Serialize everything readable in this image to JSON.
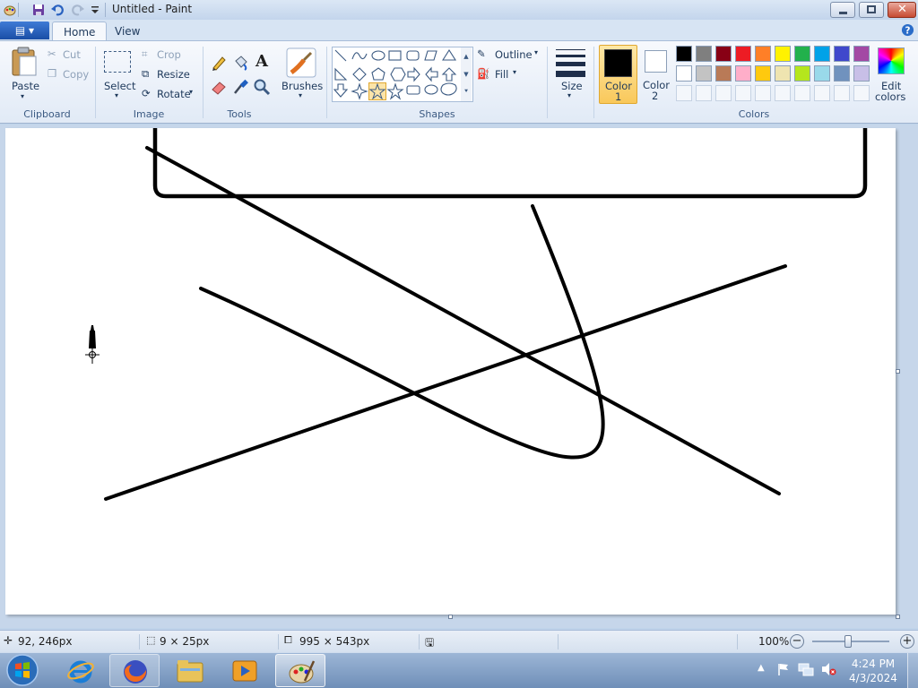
{
  "window": {
    "title": "Untitled - Paint",
    "quick_access": [
      "paint-app-icon",
      "save-icon",
      "undo-icon",
      "redo-icon",
      "customize-qat-icon"
    ],
    "controls": [
      "minimize",
      "maximize",
      "close"
    ]
  },
  "tabs": {
    "file_icon": "file-menu-icon",
    "home": "Home",
    "view": "View"
  },
  "clipboard": {
    "paste": "Paste",
    "cut": "Cut",
    "copy": "Copy",
    "group": "Clipboard"
  },
  "image": {
    "select": "Select",
    "crop": "Crop",
    "resize": "Resize",
    "rotate": "Rotate",
    "group": "Image"
  },
  "tools": {
    "items": [
      "pencil-icon",
      "fill-icon",
      "text-icon",
      "eraser-icon",
      "color-picker-icon",
      "magnifier-icon"
    ],
    "text_glyph": "A",
    "group": "Tools"
  },
  "brushes": {
    "label": "Brushes"
  },
  "shapes": {
    "outline": "Outline",
    "fill": "Fill",
    "group": "Shapes",
    "selected": "star-5"
  },
  "size": {
    "label": "Size"
  },
  "colors": {
    "color1": {
      "label1": "Color",
      "label2": "1",
      "value": "#000000"
    },
    "color2": {
      "label1": "Color",
      "label2": "2",
      "value": "#ffffff"
    },
    "palette_row1": [
      "#000000",
      "#7f7f7f",
      "#880015",
      "#ed1c24",
      "#ff7f27",
      "#fff200",
      "#22b14c",
      "#00a2e8",
      "#3f48cc",
      "#a349a4"
    ],
    "palette_row2": [
      "#ffffff",
      "#c3c3c3",
      "#b97a57",
      "#ffaec9",
      "#ffc90e",
      "#efe4b0",
      "#b5e61d",
      "#99d9ea",
      "#7092be",
      "#c8bfe7"
    ],
    "edit_label1": "Edit",
    "edit_label2": "colors",
    "group": "Colors"
  },
  "status": {
    "cursor_pos": "92, 246px",
    "selection_size": "9 × 25px",
    "canvas_size": "995 × 543px",
    "zoom": "100%",
    "zoom_fraction": 0.46
  },
  "taskbar": {
    "apps": [
      "start-button",
      "internet-explorer-icon",
      "firefox-icon",
      "file-explorer-icon",
      "media-player-icon",
      "paint-taskbar-icon"
    ],
    "active": "paint-taskbar-icon",
    "time": "4:24 PM",
    "date": "4/3/2024"
  }
}
